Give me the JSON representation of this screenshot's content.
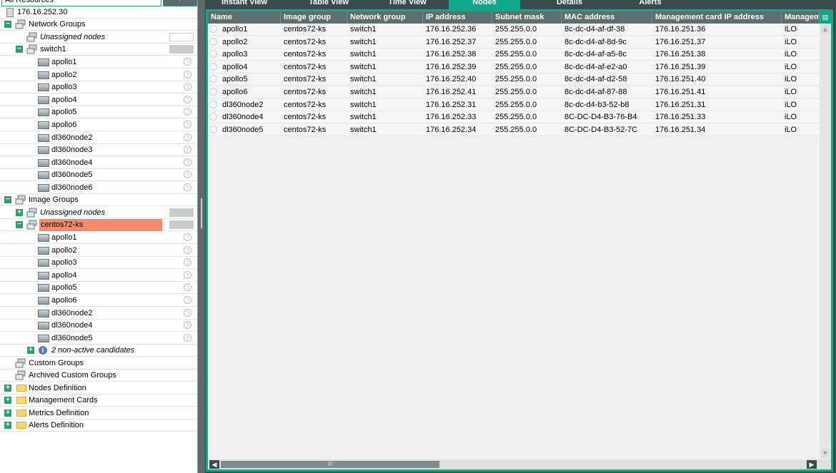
{
  "filter": {
    "value": "All Resources"
  },
  "tree": {
    "root_ip": "176.16.252.30",
    "network_groups": "Network Groups",
    "unassigned_nodes": "Unassigned nodes",
    "switch1": "switch1",
    "switch_nodes": [
      "apollo1",
      "apollo2",
      "apollo3",
      "apollo4",
      "apollo5",
      "apollo6",
      "dl360node2",
      "dl360node3",
      "dl360node4",
      "dl360node5",
      "dl360node6"
    ],
    "image_groups": "Image Groups",
    "image_unassigned": "Unassigned nodes",
    "centos": "centos72-ks",
    "centos_nodes": [
      "apollo1",
      "apollo2",
      "apollo3",
      "apollo4",
      "apollo5",
      "apollo6",
      "dl360node2",
      "dl360node4",
      "dl360node5"
    ],
    "candidates": "2 non-active candidates",
    "custom_groups": "Custom Groups",
    "archived_custom_groups": "Archived Custom Groups",
    "nodes_definition": "Nodes Definition",
    "management_cards": "Management Cards",
    "metrics_definition": "Metrics Definition",
    "alerts_definition": "Alerts Definition"
  },
  "tabs": [
    "Instant View",
    "Table View",
    "Time View",
    "Nodes",
    "Details",
    "Alerts"
  ],
  "active_tab": "Nodes",
  "table": {
    "columns": [
      "Name",
      "Image group",
      "Network group",
      "IP address",
      "Subnet mask",
      "MAC address",
      "Management card IP address",
      "Managem"
    ],
    "rows": [
      [
        "apollo1",
        "centos72-ks",
        "switch1",
        "176.16.252.36",
        "255.255.0.0",
        "8c-dc-d4-af-df-38",
        "176.16.251.36",
        "iLO"
      ],
      [
        "apollo2",
        "centos72-ks",
        "switch1",
        "176.16.252.37",
        "255.255.0.0",
        "8c-dc-d4-af-8d-9c",
        "176.16.251.37",
        "iLO"
      ],
      [
        "apollo3",
        "centos72-ks",
        "switch1",
        "176.16.252.38",
        "255.255.0.0",
        "8c-dc-d4-af-a5-8c",
        "176.16.251.38",
        "iLO"
      ],
      [
        "apollo4",
        "centos72-ks",
        "switch1",
        "176.16.252.39",
        "255.255.0.0",
        "8c-dc-d4-af-e2-a0",
        "176.16.251.39",
        "iLO"
      ],
      [
        "apollo5",
        "centos72-ks",
        "switch1",
        "176.16.252.40",
        "255.255.0.0",
        "8c-dc-d4-af-d2-58",
        "176.16.251.40",
        "iLO"
      ],
      [
        "apollo6",
        "centos72-ks",
        "switch1",
        "176.16.252.41",
        "255.255.0.0",
        "8c-dc-d4-af-87-88",
        "176.16.251.41",
        "iLO"
      ],
      [
        "dl360node2",
        "centos72-ks",
        "switch1",
        "176.16.252.31",
        "255.255.0.0",
        "8c-dc-d4-b3-52-b8",
        "176.16.251.31",
        "iLO"
      ],
      [
        "dl360node4",
        "centos72-ks",
        "switch1",
        "176.16.252.33",
        "255.255.0.0",
        "8C-DC-D4-B3-76-B4",
        "176.16.251.33",
        "iLO"
      ],
      [
        "dl360node5",
        "centos72-ks",
        "switch1",
        "176.16.252.34",
        "255.255.0.0",
        "8C-DC-D4-B3-52-7C",
        "176.16.251.34",
        "iLO"
      ]
    ]
  },
  "scrollbar": {
    "thumb_label": "III"
  },
  "colors": {
    "accent": "#10a78a",
    "selected": "#f5896a",
    "dark": "#3a4b4b",
    "header": "#5d6e6e",
    "tree_toggle": "#2da06c"
  }
}
